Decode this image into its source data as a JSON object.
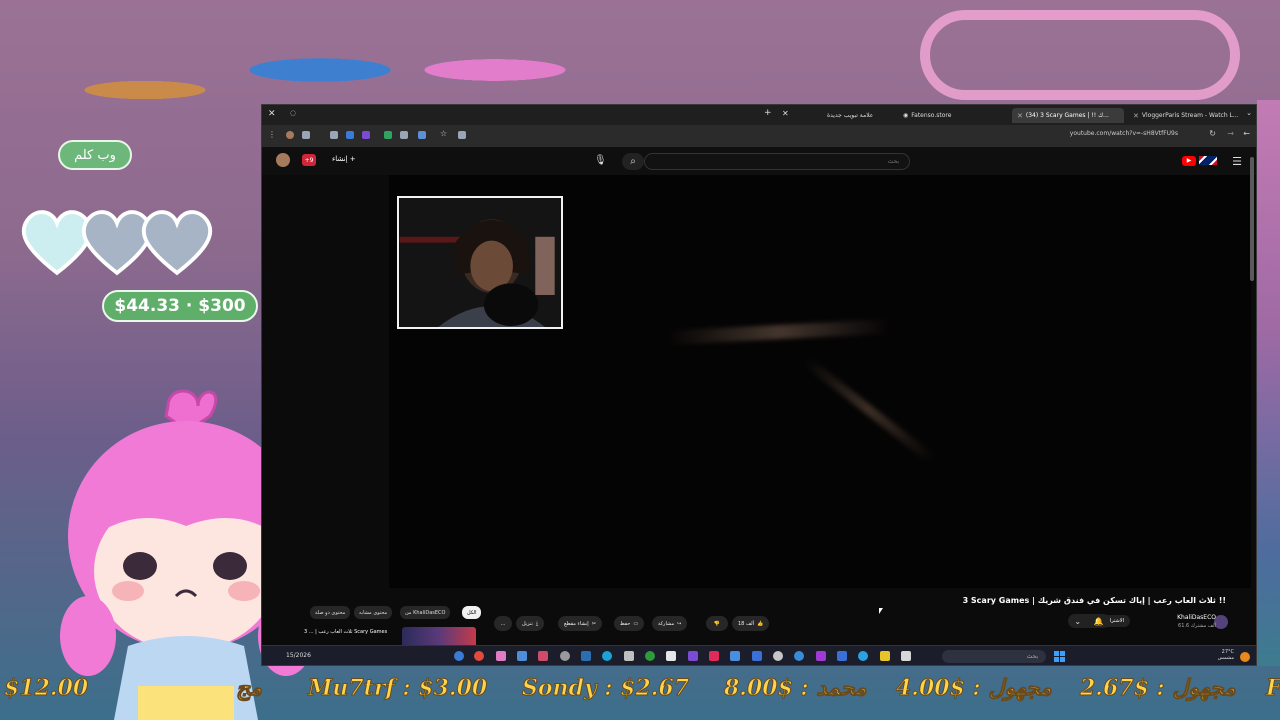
{
  "overlay": {
    "name_bubble": "وب كلم",
    "goal": "$44.33 · $300",
    "hearts": 3,
    "ticker": [
      {
        "text": "$12.00"
      },
      {
        "text": "مج"
      },
      {
        "text": "Mu7trf : $3.00"
      },
      {
        "text": "Sondy : $2.67"
      },
      {
        "text": "8.00$ : محمد"
      },
      {
        "text": "4.00$ : مجهول"
      },
      {
        "text": "2.67$ : مجهول"
      },
      {
        "text": "F"
      }
    ]
  },
  "browser": {
    "tabs": [
      {
        "label": "علامة تبويب جديدة",
        "active": false
      },
      {
        "label": "Fatenso.store",
        "active": false
      },
      {
        "label": "(34) 3 Scary Games | !! ك...",
        "active": true
      },
      {
        "label": "VloggerParis Stream - Watch L...",
        "active": false
      }
    ],
    "url": "youtube.com/watch?v=-sH8VtfFU9s"
  },
  "youtube": {
    "create_label": "إنشاء",
    "notif_count": "+9",
    "search_placeholder": "بحث",
    "title": "3 Scary Games | ثلاث العاب رعب | إياك تسكن في فندق شريك !!",
    "channel": "KhaliDasECO",
    "subs": "61.6 ألف مشترك",
    "subscribe_label": "الاشتراك",
    "likes": "18 ألف",
    "share_label": "مشاركة",
    "save_label": "حفظ",
    "clip_label": "إنشاء مقطع",
    "download_label": "تنزيل",
    "more_label": "...",
    "chips": [
      "الكل",
      "من KhaliDasECO",
      "محتوى مشابه",
      "محتوى ذو صلة"
    ],
    "rec_title": "ثلاث العاب رعب | ... 3 Scary Games"
  },
  "taskbar": {
    "search_placeholder": "بحث",
    "date": "15/2026",
    "weather": "27°C",
    "weather_sub": "مشمس"
  }
}
